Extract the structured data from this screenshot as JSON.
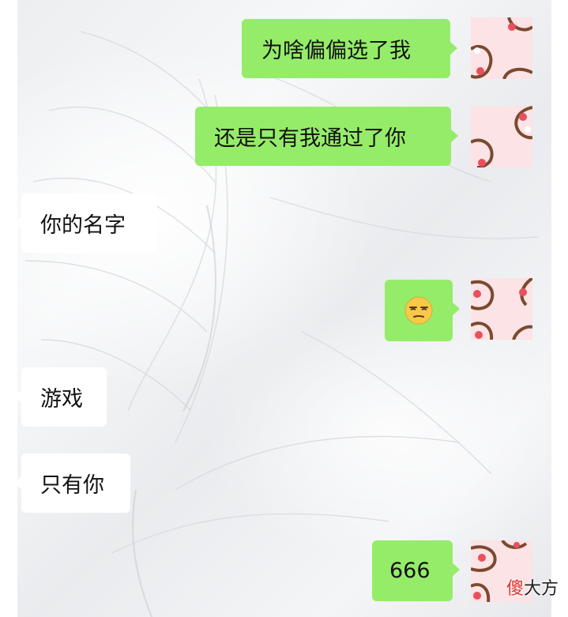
{
  "messages": [
    {
      "sender": "me",
      "type": "text",
      "text": "为啥偏偏选了我"
    },
    {
      "sender": "me",
      "type": "text",
      "text": "还是只有我通过了你"
    },
    {
      "sender": "them",
      "type": "text",
      "text": "你的名字"
    },
    {
      "sender": "me",
      "type": "emoji",
      "text": "",
      "icon": "smug-face-emoji"
    },
    {
      "sender": "them",
      "type": "text",
      "text": "游戏"
    },
    {
      "sender": "them",
      "type": "text",
      "text": "只有你"
    },
    {
      "sender": "me",
      "type": "text",
      "text": "666"
    }
  ],
  "watermark": {
    "first_char": "傻",
    "rest": "大方"
  },
  "colors": {
    "my_bubble": "#95ec69",
    "their_bubble": "#ffffff",
    "avatar_bg": "#fbe3e6",
    "avatar_pattern": "#7a4a2f",
    "avatar_dot": "#e8505b",
    "watermark_accent": "#e0302d"
  }
}
